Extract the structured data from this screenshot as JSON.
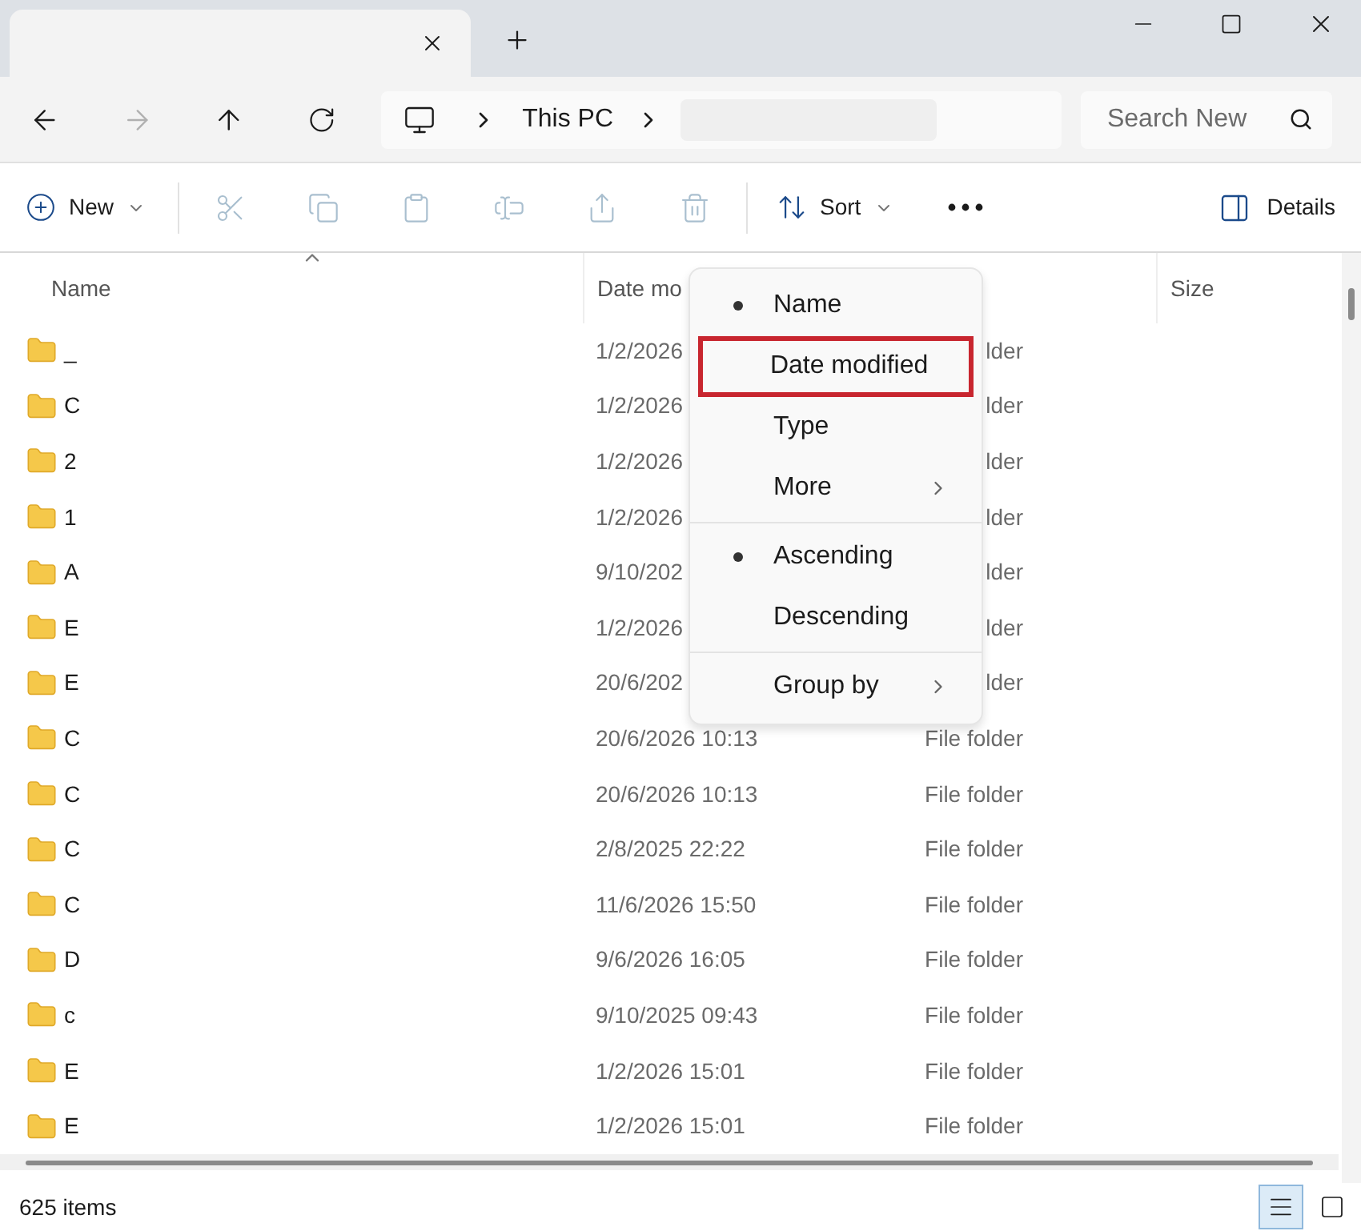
{
  "address": {
    "segments": [
      "This PC"
    ]
  },
  "search": {
    "placeholder": "Search New"
  },
  "toolbar": {
    "new": "New",
    "sort": "Sort",
    "details": "Details",
    "actions": [
      {
        "kind": "cut",
        "disabled": true
      },
      {
        "kind": "copy",
        "disabled": true
      },
      {
        "kind": "paste",
        "disabled": true
      },
      {
        "kind": "rename",
        "disabled": true
      },
      {
        "kind": "share",
        "disabled": true
      },
      {
        "kind": "delete",
        "disabled": true
      }
    ]
  },
  "table": {
    "columns": [
      "Name",
      "Date mo",
      "",
      "Size"
    ],
    "rows": [
      {
        "name": "_",
        "date": "1/2/2026",
        "type": "lder"
      },
      {
        "name": "C",
        "date": "1/2/2026",
        "type": "lder"
      },
      {
        "name": "2",
        "date": "1/2/2026",
        "type": "lder"
      },
      {
        "name": "1",
        "date": "1/2/2026",
        "type": "lder"
      },
      {
        "name": "A",
        "date": "9/10/202",
        "type": "lder"
      },
      {
        "name": "E",
        "date": "1/2/2026",
        "type": "lder"
      },
      {
        "name": "E",
        "date": "20/6/202",
        "type": "lder"
      },
      {
        "name": "C",
        "date": "20/6/2026 10:13",
        "type": "File folder"
      },
      {
        "name": "C",
        "date": "20/6/2026 10:13",
        "type": "File folder"
      },
      {
        "name": "C",
        "date": "2/8/2025 22:22",
        "type": "File folder"
      },
      {
        "name": "C",
        "date": "11/6/2026 15:50",
        "type": "File folder"
      },
      {
        "name": "D",
        "date": "9/6/2026 16:05",
        "type": "File folder"
      },
      {
        "name": "c",
        "date": "9/10/2025 09:43",
        "type": "File folder"
      },
      {
        "name": "E",
        "date": "1/2/2026 15:01",
        "type": "File folder"
      },
      {
        "name": "E",
        "date": "1/2/2026 15:01",
        "type": "File folder"
      }
    ]
  },
  "sort_menu": {
    "groups": [
      [
        {
          "label": "Name",
          "selected": true,
          "submenu": false,
          "highlighted": false
        },
        {
          "label": "Date modified",
          "selected": false,
          "submenu": false,
          "highlighted": true
        },
        {
          "label": "Type",
          "selected": false,
          "submenu": false,
          "highlighted": false
        },
        {
          "label": "More",
          "selected": false,
          "submenu": true,
          "highlighted": false
        }
      ],
      [
        {
          "label": "Ascending",
          "selected": true,
          "submenu": false,
          "highlighted": false
        },
        {
          "label": "Descending",
          "selected": false,
          "submenu": false,
          "highlighted": false
        }
      ],
      [
        {
          "label": "Group by",
          "selected": false,
          "submenu": true,
          "highlighted": false
        }
      ]
    ]
  },
  "status_bar": {
    "count": "625 items",
    "views": [
      {
        "kind": "details",
        "selected": true
      },
      {
        "kind": "tiles",
        "selected": false
      }
    ]
  }
}
